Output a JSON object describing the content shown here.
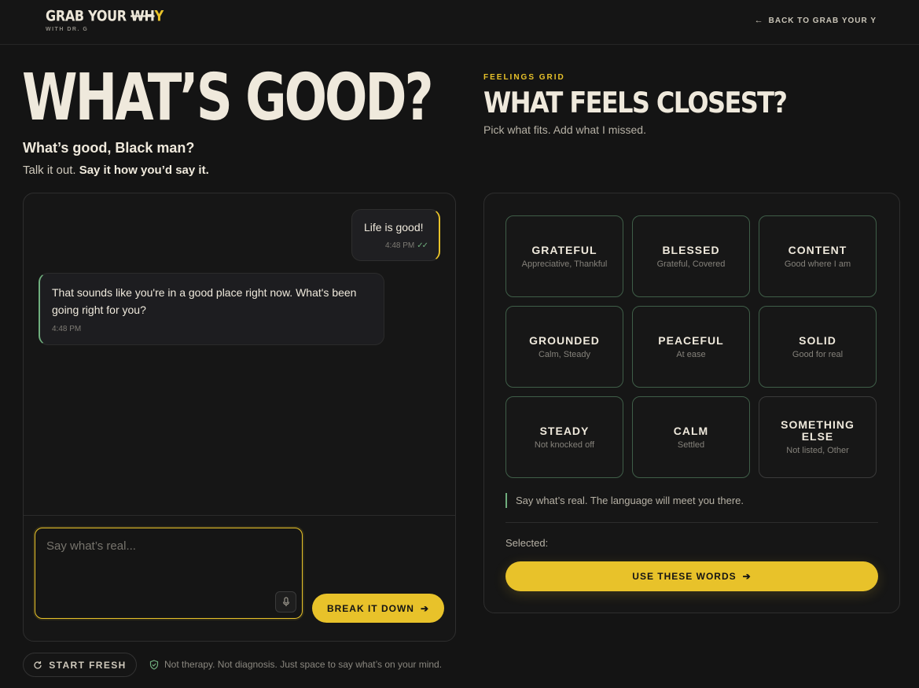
{
  "header": {
    "logo_main": "GRAB YOUR ",
    "logo_wh": "WH",
    "logo_y": "Y",
    "logo_sub": "WITH DR. G",
    "back_label": "BACK TO GRAB YOUR Y"
  },
  "hero": {
    "title": "WHAT’S GOOD?",
    "subtitle": "What’s good, Black man?",
    "line_plain": "Talk it out.",
    "line_bold": "Say it how you’d say it."
  },
  "chat": {
    "messages": [
      {
        "role": "user",
        "text": "Life is good!",
        "time": "4:48 PM"
      },
      {
        "role": "assistant",
        "text": "That sounds like you're in a good place right now. What's been going right for you?",
        "time": "4:48 PM"
      }
    ],
    "input_placeholder": "Say what’s real...",
    "input_value": "",
    "submit_label": "BREAK IT DOWN"
  },
  "footer": {
    "start_fresh_label": "START FRESH",
    "disclaimer": "Not therapy. Not diagnosis. Just space to say what’s on your mind."
  },
  "feelings": {
    "eyebrow": "FEELINGS GRID",
    "title": "WHAT FEELS CLOSEST?",
    "subtitle": "Pick what fits. Add what I missed.",
    "cards": [
      {
        "name": "GRATEFUL",
        "desc": "Appreciative, Thankful"
      },
      {
        "name": "BLESSED",
        "desc": "Grateful, Covered"
      },
      {
        "name": "CONTENT",
        "desc": "Good where I am"
      },
      {
        "name": "GROUNDED",
        "desc": "Calm, Steady"
      },
      {
        "name": "PEACEFUL",
        "desc": "At ease"
      },
      {
        "name": "SOLID",
        "desc": "Good for real"
      },
      {
        "name": "STEADY",
        "desc": "Not knocked off"
      },
      {
        "name": "CALM",
        "desc": "Settled"
      },
      {
        "name": "SOMETHING ELSE",
        "desc": "Not listed, Other"
      }
    ],
    "hint": "Say what’s real. The language will meet you there.",
    "selected_label": "Selected:",
    "use_label": "USE THESE WORDS"
  },
  "colors": {
    "accent": "#e8c22a",
    "positive": "#6fae7d",
    "background": "#141414",
    "text": "#efe9dc"
  }
}
